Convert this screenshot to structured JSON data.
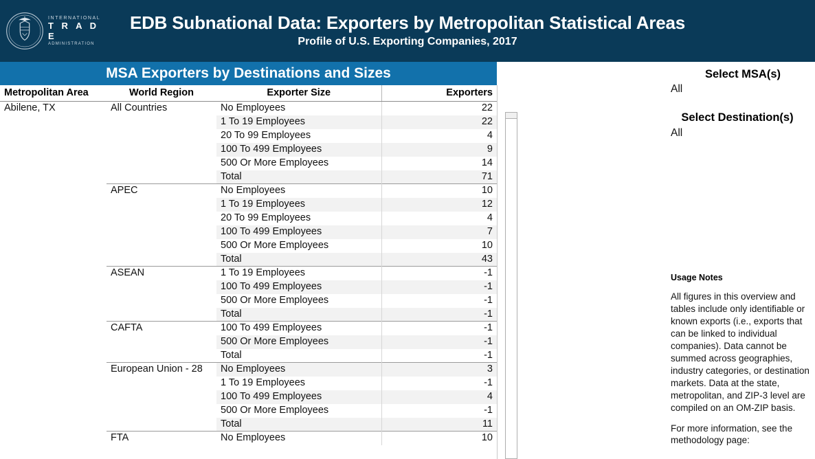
{
  "header": {
    "logo": {
      "seal_icon": "dept-of-commerce-seal-icon",
      "line1": "INTERNATIONAL",
      "line2": "T R A D E",
      "line3": "ADMINISTRATION"
    },
    "title": "EDB Subnational Data: Exporters by Metropolitan Statistical Areas",
    "subtitle": "Profile of U.S. Exporting Companies, 2017",
    "background_color": "#0a3a58",
    "text_color": "#ffffff"
  },
  "table_panel": {
    "title": "MSA Exporters by Destinations and Sizes",
    "title_background_color": "#1271ab",
    "columns": [
      "Metropolitan Area",
      "World Region",
      "Exporter Size",
      "Exporters"
    ],
    "rows": [
      {
        "metro": "Abilene, TX",
        "region": "All Countries",
        "size": "No Employees",
        "value": "22",
        "group_start": true
      },
      {
        "metro": "",
        "region": "",
        "size": "1 To 19 Employees",
        "value": "22",
        "group_start": false
      },
      {
        "metro": "",
        "region": "",
        "size": "20 To 99 Employees",
        "value": "4",
        "group_start": false
      },
      {
        "metro": "",
        "region": "",
        "size": "100 To 499 Employees",
        "value": "9",
        "group_start": false
      },
      {
        "metro": "",
        "region": "",
        "size": "500 Or More Employees",
        "value": "14",
        "group_start": false
      },
      {
        "metro": "",
        "region": "",
        "size": "Total",
        "value": "71",
        "group_start": false
      },
      {
        "metro": "",
        "region": "APEC",
        "size": "No Employees",
        "value": "10",
        "group_start": true
      },
      {
        "metro": "",
        "region": "",
        "size": "1 To 19 Employees",
        "value": "12",
        "group_start": false
      },
      {
        "metro": "",
        "region": "",
        "size": "20 To 99 Employees",
        "value": "4",
        "group_start": false
      },
      {
        "metro": "",
        "region": "",
        "size": "100 To 499 Employees",
        "value": "7",
        "group_start": false
      },
      {
        "metro": "",
        "region": "",
        "size": "500 Or More Employees",
        "value": "10",
        "group_start": false
      },
      {
        "metro": "",
        "region": "",
        "size": "Total",
        "value": "43",
        "group_start": false
      },
      {
        "metro": "",
        "region": "ASEAN",
        "size": "1 To 19 Employees",
        "value": "-1",
        "group_start": true
      },
      {
        "metro": "",
        "region": "",
        "size": "100 To 499 Employees",
        "value": "-1",
        "group_start": false
      },
      {
        "metro": "",
        "region": "",
        "size": "500 Or More Employees",
        "value": "-1",
        "group_start": false
      },
      {
        "metro": "",
        "region": "",
        "size": "Total",
        "value": "-1",
        "group_start": false
      },
      {
        "metro": "",
        "region": "CAFTA",
        "size": "100 To 499 Employees",
        "value": "-1",
        "group_start": true
      },
      {
        "metro": "",
        "region": "",
        "size": "500 Or More Employees",
        "value": "-1",
        "group_start": false
      },
      {
        "metro": "",
        "region": "",
        "size": "Total",
        "value": "-1",
        "group_start": false
      },
      {
        "metro": "",
        "region": "European Union - 28",
        "size": "No Employees",
        "value": "3",
        "group_start": true
      },
      {
        "metro": "",
        "region": "",
        "size": "1 To 19 Employees",
        "value": "-1",
        "group_start": false
      },
      {
        "metro": "",
        "region": "",
        "size": "100 To 499 Employees",
        "value": "4",
        "group_start": false
      },
      {
        "metro": "",
        "region": "",
        "size": "500 Or More Employees",
        "value": "-1",
        "group_start": false
      },
      {
        "metro": "",
        "region": "",
        "size": "Total",
        "value": "11",
        "group_start": false
      },
      {
        "metro": "",
        "region": "FTA",
        "size": "No Employees",
        "value": "10",
        "group_start": true
      }
    ]
  },
  "sidebar": {
    "msa_filter_label": "Select MSA(s)",
    "msa_filter_value": "All",
    "destination_filter_label": "Select Destination(s)",
    "destination_filter_value": "All"
  },
  "notes": {
    "title": "Usage Notes",
    "paragraph1": "All figures in this overview and tables include only identifiable or known exports (i.e., exports that can be linked to individual companies). Data cannot be summed across geographies, industry categories, or destination markets. Data at the state, metropolitan, and ZIP-3 level are compiled on an OM-ZIP basis.",
    "paragraph2": "For more information, see the methodology page:"
  }
}
